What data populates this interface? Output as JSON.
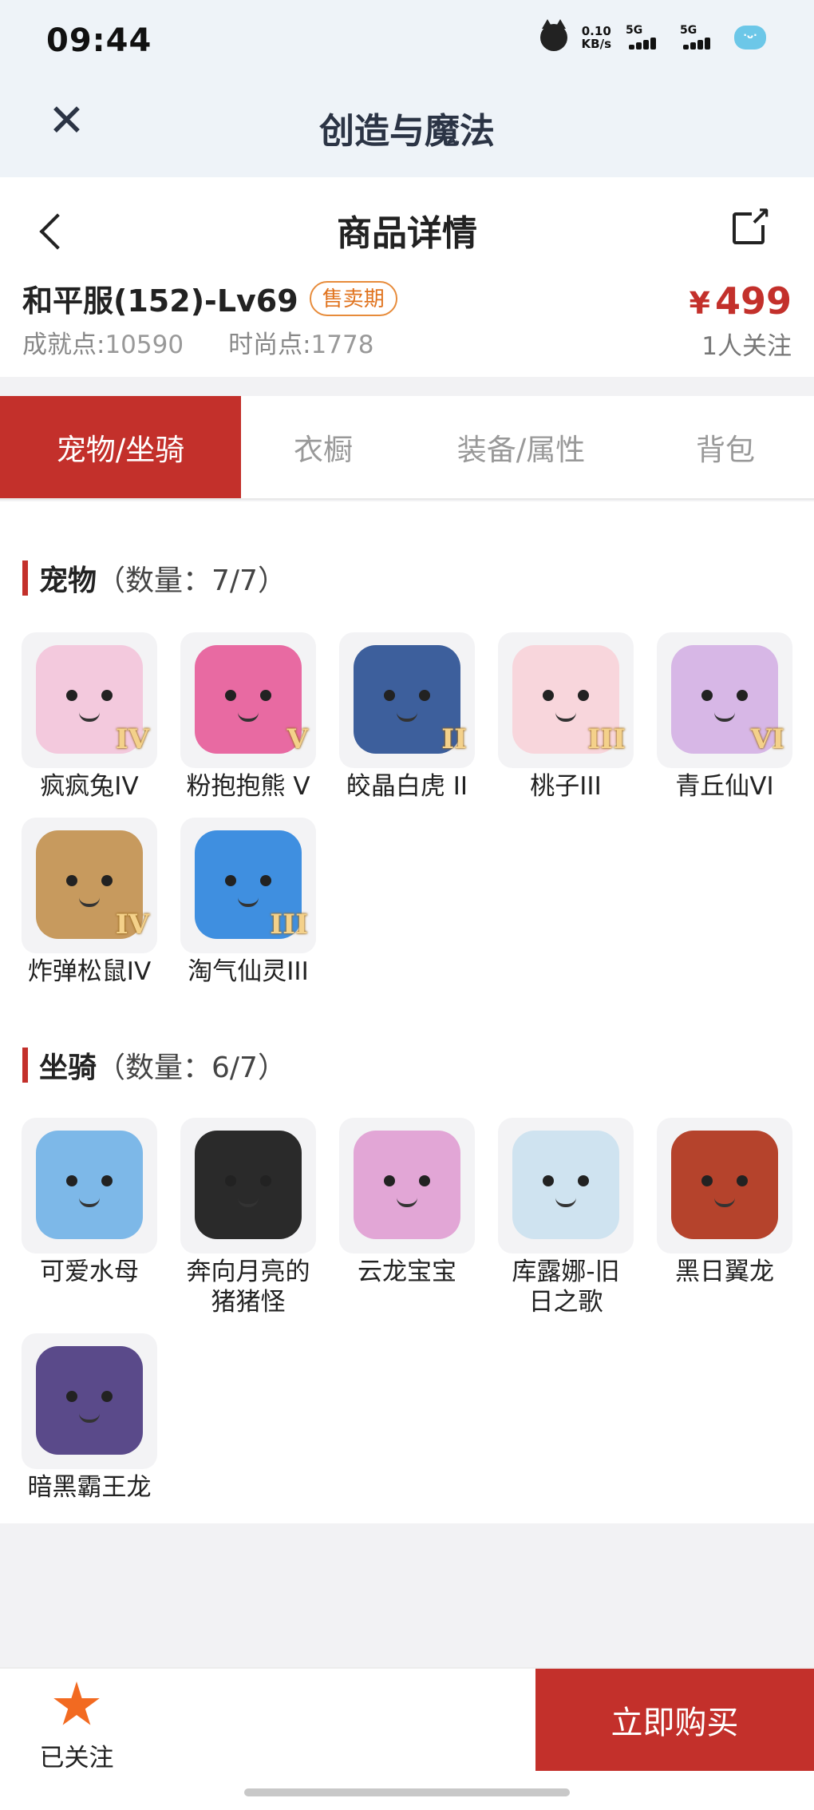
{
  "status_bar": {
    "time": "09:44",
    "speed_value": "0.10",
    "speed_unit": "KB/s",
    "net1": "5G",
    "net2": "5G"
  },
  "app": {
    "title": "创造与魔法"
  },
  "header": {
    "title": "商品详情"
  },
  "item": {
    "name": "和平服(152)-Lv69",
    "badge": "售卖期",
    "achievement_label": "成就点:",
    "achievement_value": "10590",
    "fashion_label": "时尚点:",
    "fashion_value": "1778",
    "price_currency": "¥",
    "price": "499",
    "followers": "1人关注"
  },
  "tabs": [
    {
      "label": "宠物/坐骑",
      "active": true
    },
    {
      "label": "衣橱",
      "active": false
    },
    {
      "label": "装备/属性",
      "active": false
    },
    {
      "label": "背包",
      "active": false
    }
  ],
  "pets": {
    "title": "宠物",
    "count": "（数量：7/7）",
    "items": [
      {
        "name": "疯疯兔IV",
        "rank": "IV",
        "color": "#f3c9dd"
      },
      {
        "name": "粉抱抱熊 V",
        "rank": "V",
        "color": "#e86aa2"
      },
      {
        "name": "皎晶白虎 II",
        "rank": "II",
        "color": "#3d5f9c"
      },
      {
        "name": "桃子III",
        "rank": "III",
        "color": "#f8d6dc"
      },
      {
        "name": "青丘仙VI",
        "rank": "VI",
        "color": "#d7b7e6"
      },
      {
        "name": "炸弹松鼠IV",
        "rank": "IV",
        "color": "#c79a5e"
      },
      {
        "name": "淘气仙灵III",
        "rank": "III",
        "color": "#3f8fe0"
      }
    ]
  },
  "mounts": {
    "title": "坐骑",
    "count": "（数量：6/7）",
    "items": [
      {
        "name": "可爱水母",
        "color": "#7db8e8"
      },
      {
        "name": "奔向月亮的猪猪怪",
        "color": "#2a2a2a"
      },
      {
        "name": "云龙宝宝",
        "color": "#e2a6d6"
      },
      {
        "name": "库露娜-旧日之歌",
        "color": "#cfe3f0"
      },
      {
        "name": "黑日翼龙",
        "color": "#b5432c"
      },
      {
        "name": "暗黑霸王龙",
        "color": "#5a4a8a"
      }
    ]
  },
  "bottom": {
    "follow_label": "已关注",
    "buy_label": "立即购买"
  }
}
